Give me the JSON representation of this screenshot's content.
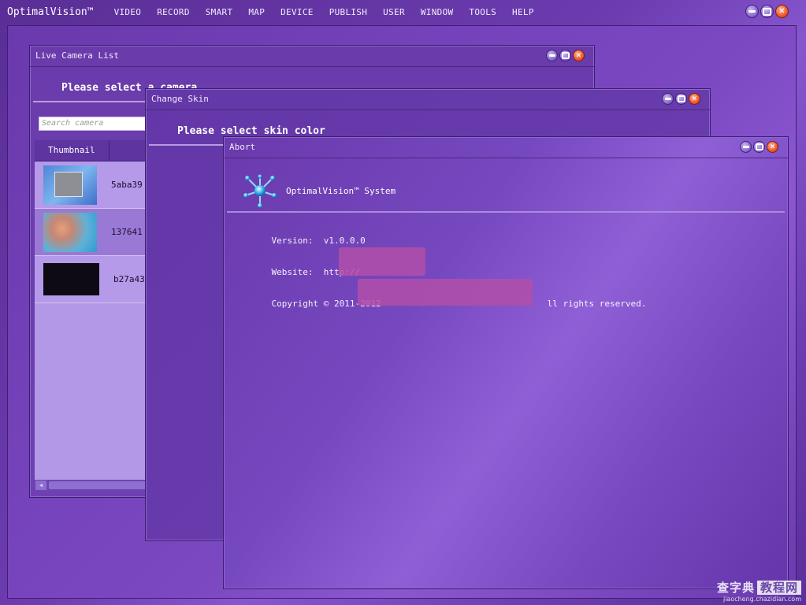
{
  "app": {
    "title": "OptimalVision™",
    "menu": [
      "VIDEO",
      "RECORD",
      "SMART",
      "MAP",
      "DEVICE",
      "PUBLISH",
      "USER",
      "WINDOW",
      "TOOLS",
      "HELP"
    ]
  },
  "camera_window": {
    "title": "Live Camera List",
    "heading": "Please select a camera",
    "search_placeholder": "Search camera",
    "columns": [
      "Thumbnail"
    ],
    "rows": [
      {
        "id": "5aba39",
        "thumb": "desktop-screenshot"
      },
      {
        "id": "137641",
        "thumb": "flower-photo"
      },
      {
        "id": "b27a43",
        "thumb": "black-frame"
      }
    ]
  },
  "skin_window": {
    "title": "Change Skin",
    "heading": "Please select skin color"
  },
  "about_window": {
    "title": "Abort",
    "product": "OptimalVision™ System",
    "version_label": "Version:",
    "version": "v1.0.0.0",
    "website_label": "Website:",
    "website": "http://",
    "copyright_prefix": "Copyright © 2011-2012",
    "copyright_suffix": "ll rights reserved."
  },
  "watermark": {
    "big": "查字典",
    "boxed": "教程网",
    "small": "jiaocheng.chazidian.com"
  },
  "colors": {
    "background": "#6c3cb0",
    "close_button": "#f0602f",
    "redaction": "#b24fa8"
  }
}
